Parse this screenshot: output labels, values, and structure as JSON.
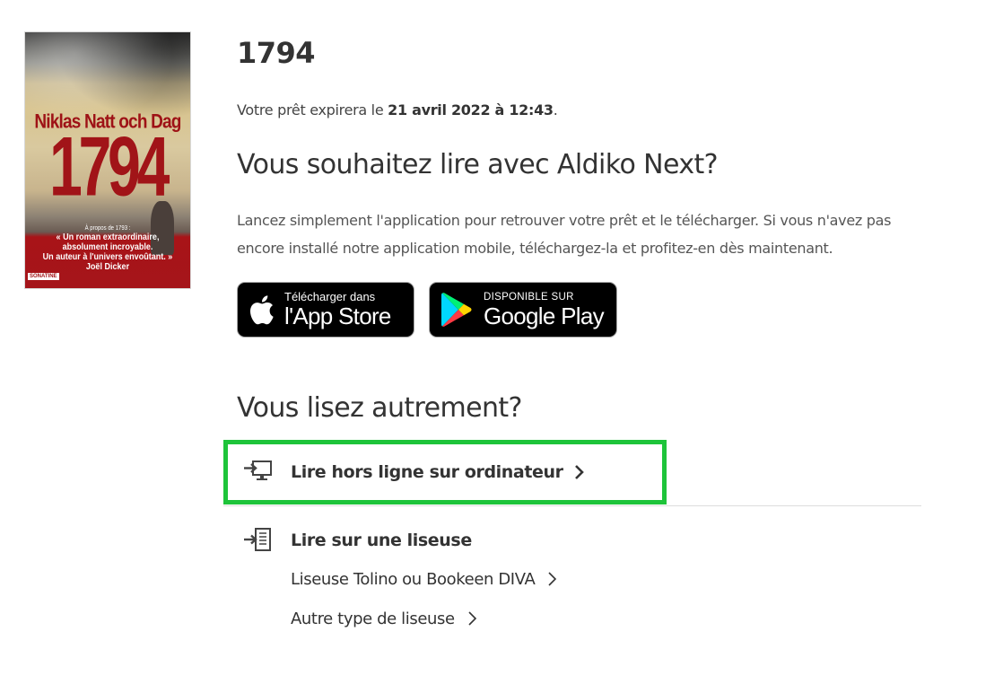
{
  "book": {
    "title": "1794",
    "cover": {
      "author": "Niklas Natt och Dag",
      "title": "1794",
      "quote_intro": "À propos de 1793 :",
      "quote_line1": "« Un roman extraordinaire,",
      "quote_line2": "absolument incroyable.",
      "quote_line3": "Un auteur à l'univers envoûtant. »",
      "quote_author": "Joël Dicker",
      "publisher": "SONATINE"
    }
  },
  "loan": {
    "prefix": "Votre prêt expirera le ",
    "date": "21 avril 2022 à 12:43",
    "suffix": "."
  },
  "aldiko": {
    "heading": "Vous souhaitez lire avec Aldiko Next?",
    "description": "Lancez simplement l'application pour retrouver votre prêt et le télécharger. Si vous n'avez pas encore installé notre application mobile, téléchargez-la et profitez-en dès maintenant."
  },
  "stores": {
    "apple": {
      "small": "Télécharger dans",
      "big": "l'App Store",
      "icon": "apple-icon"
    },
    "google": {
      "small": "DISPONIBLE SUR",
      "big": "Google Play",
      "icon": "google-play-icon"
    }
  },
  "other": {
    "heading": "Vous lisez autrement?",
    "computer": {
      "label": "Lire hors ligne sur ordinateur",
      "icon": "computer-download-icon"
    },
    "ereader": {
      "label": "Lire sur une liseuse",
      "icon": "ereader-download-icon",
      "options": [
        "Liseuse Tolino ou Bookeen DIVA",
        "Autre type de liseuse"
      ]
    }
  },
  "colors": {
    "highlight": "#1ec43a",
    "text": "#333333",
    "cover_red": "#a11418"
  }
}
